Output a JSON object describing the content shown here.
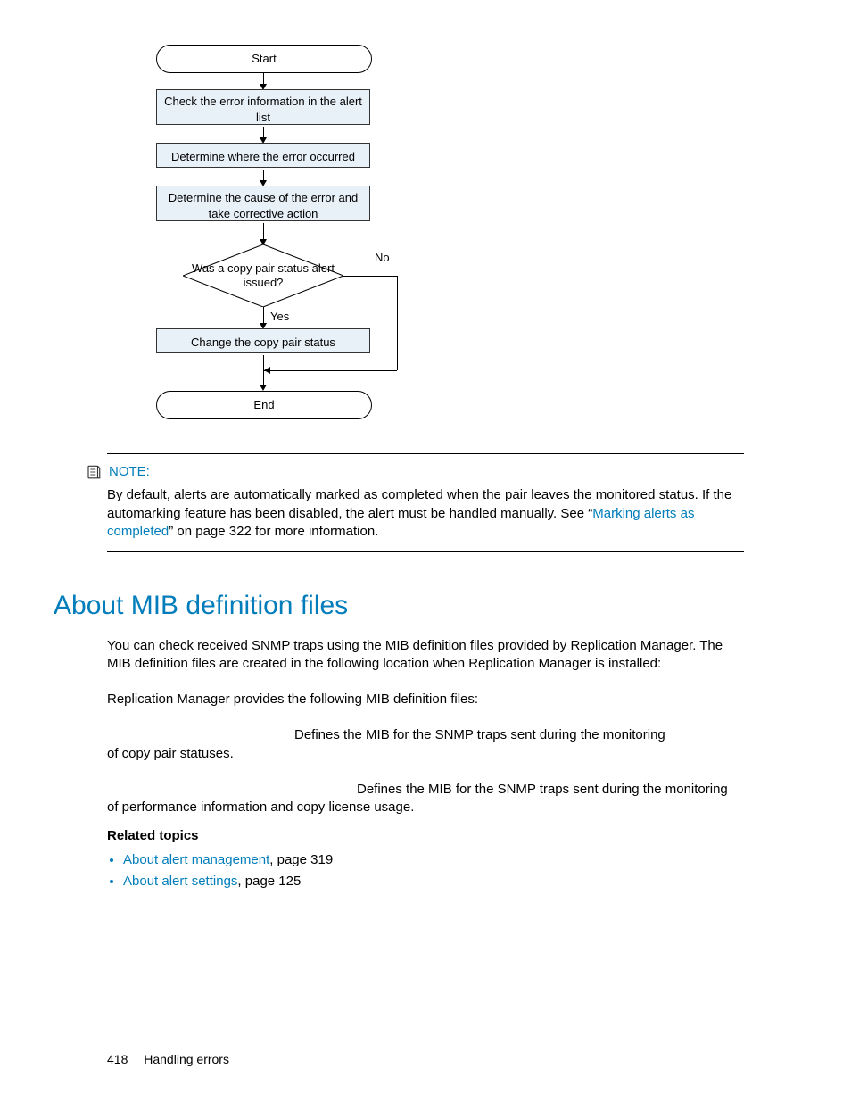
{
  "flowchart": {
    "start": "Start",
    "step1": "Check the error information in the alert list",
    "step2": "Determine where the error occurred",
    "step3": "Determine the cause of the error and take corrective action",
    "decision": "Was a copy pair status alert issued?",
    "dec_yes": "Yes",
    "dec_no": "No",
    "step4": "Change the copy pair status",
    "end": "End"
  },
  "note": {
    "title": "NOTE:",
    "body_pre": "By default, alerts are automatically marked as completed when the pair leaves the monitored status. If the automarking feature has been disabled, the alert must be handled manually. See “",
    "link": "Marking alerts as completed",
    "body_post": "” on page 322 for more information."
  },
  "section": {
    "heading": "About MIB definition files",
    "p1": "You can check received SNMP traps using the MIB definition files provided by Replication Manager. The MIB definition files are created in the following location when Replication Manager is installed:",
    "p2": "Replication Manager provides the following MIB definition files:",
    "def1a": "Defines the MIB for the SNMP traps sent during the monitoring",
    "def1b": "of copy pair statuses.",
    "def2a": "Defines the MIB for the SNMP traps sent during the monitoring",
    "def2b": "of performance information and copy license usage."
  },
  "related": {
    "heading": "Related topics",
    "items": [
      {
        "link": "About alert management",
        "suffix": ", page 319"
      },
      {
        "link": "About alert settings",
        "suffix": ", page 125"
      }
    ]
  },
  "footer": {
    "page": "418",
    "chapter": "Handling errors"
  }
}
